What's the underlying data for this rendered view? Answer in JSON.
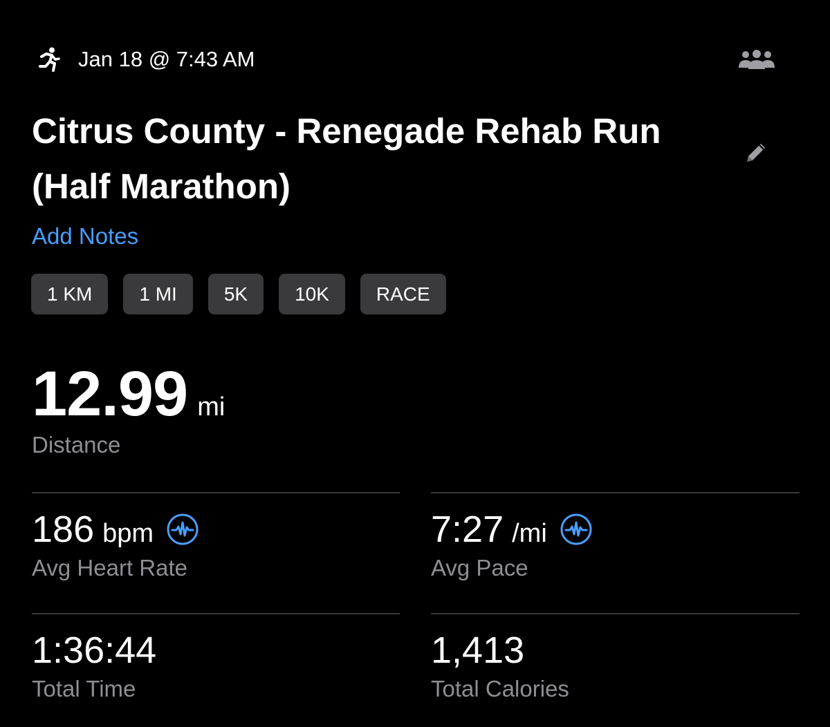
{
  "header": {
    "date_time": "Jan 18 @ 7:43 AM",
    "activity_icon": "running-person-icon",
    "group_icon": "people-group-icon"
  },
  "workout": {
    "title": "Citrus County - Renegade Rehab Run (Half Marathon)",
    "edit_icon": "pencil-icon",
    "add_notes_label": "Add Notes"
  },
  "splits": [
    "1 KM",
    "1 MI",
    "5K",
    "10K",
    "RACE"
  ],
  "distance": {
    "value": "12.99",
    "unit": "mi",
    "label": "Distance"
  },
  "metrics": {
    "heart_rate": {
      "value": "186",
      "unit": "bpm",
      "label": "Avg Heart Rate",
      "icon": "heart-rate-wave-icon"
    },
    "pace": {
      "value": "7:27",
      "unit": "/mi",
      "label": "Avg Pace",
      "icon": "heart-rate-wave-icon"
    },
    "time": {
      "value": "1:36:44",
      "label": "Total Time"
    },
    "calories": {
      "value": "1,413",
      "label": "Total Calories"
    }
  },
  "colors": {
    "background": "#000000",
    "accent": "#4a9eff",
    "chip_bg": "#3a3a3c",
    "secondary_text": "#8e8e93",
    "divider": "#38383a"
  }
}
